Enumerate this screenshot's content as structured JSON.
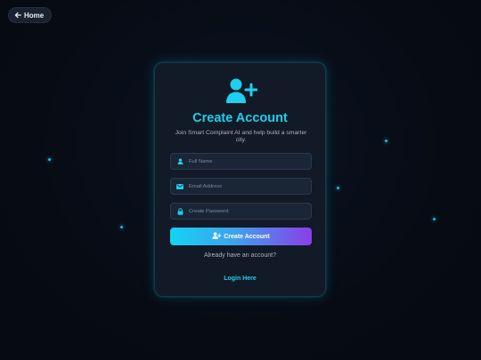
{
  "nav": {
    "home_label": "Home",
    "home_icon": "arrow-left-icon"
  },
  "card": {
    "icon": "user-plus-icon",
    "title": "Create Account",
    "subtitle": "Join Smart Complaint AI and help build a smarter city.",
    "fields": [
      {
        "icon": "user-icon",
        "placeholder": "Full Name",
        "value": ""
      },
      {
        "icon": "envelope-icon",
        "placeholder": "Email Address",
        "value": ""
      },
      {
        "icon": "lock-icon",
        "placeholder": "Create Password",
        "value": ""
      }
    ],
    "submit_label": "Create Account",
    "submit_icon": "user-plus-icon",
    "already_text": "Already have an account?",
    "login_label": "Login Here"
  },
  "colors": {
    "background": "#070b14",
    "accent": "#1ecfef",
    "gradient_start": "#14d3f5",
    "gradient_end": "#8a3ee8",
    "card": "#111a26"
  }
}
